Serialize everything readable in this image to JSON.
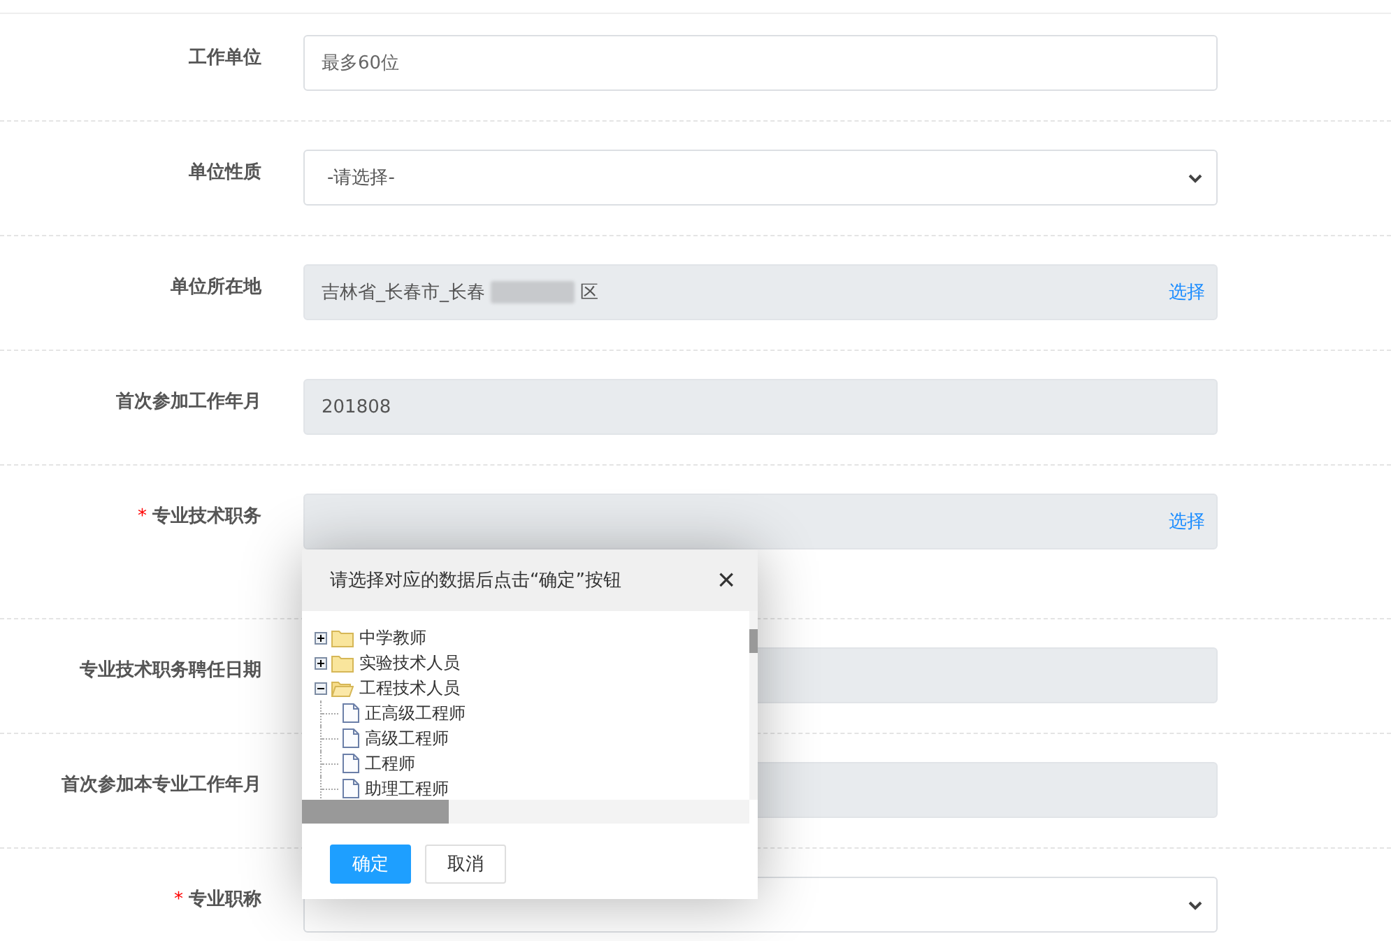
{
  "fields": [
    {
      "label": "工作单位",
      "kind": "text",
      "placeholder": "最多60位"
    },
    {
      "label": "单位性质",
      "kind": "select",
      "value": "-请选择-"
    },
    {
      "label": "单位所在地",
      "kind": "picker",
      "value": "吉林省_长春市_长春",
      "value_tail": "区",
      "redacted": true,
      "action": "选择"
    },
    {
      "label": "首次参加工作年月",
      "kind": "readonly",
      "value": "201808"
    },
    {
      "label": "专业技术职务",
      "required_mark": "*",
      "kind": "picker",
      "action": "选择"
    },
    {
      "label": "专业技术职务聘任日期",
      "kind": "readonly"
    },
    {
      "label": "首次参加本专业工作年月",
      "kind": "readonly"
    },
    {
      "label": "专业职称",
      "required_mark": "*",
      "kind": "select"
    }
  ],
  "dialog": {
    "title": "请选择对应的数据后点击“确定”按钮",
    "close": "×",
    "tree": [
      {
        "label": "中学教师",
        "kind": "folder",
        "expanded": false
      },
      {
        "label": "实验技术人员",
        "kind": "folder",
        "expanded": false
      },
      {
        "label": "工程技术人员",
        "kind": "folder",
        "expanded": true,
        "children": [
          {
            "label": "正高级工程师",
            "kind": "leaf"
          },
          {
            "label": "高级工程师",
            "kind": "leaf"
          },
          {
            "label": "工程师",
            "kind": "leaf"
          },
          {
            "label": "助理工程师",
            "kind": "leaf"
          }
        ]
      }
    ],
    "buttons": [
      {
        "label": "确定",
        "kind": "primary"
      },
      {
        "label": "取消",
        "kind": "default"
      }
    ]
  }
}
